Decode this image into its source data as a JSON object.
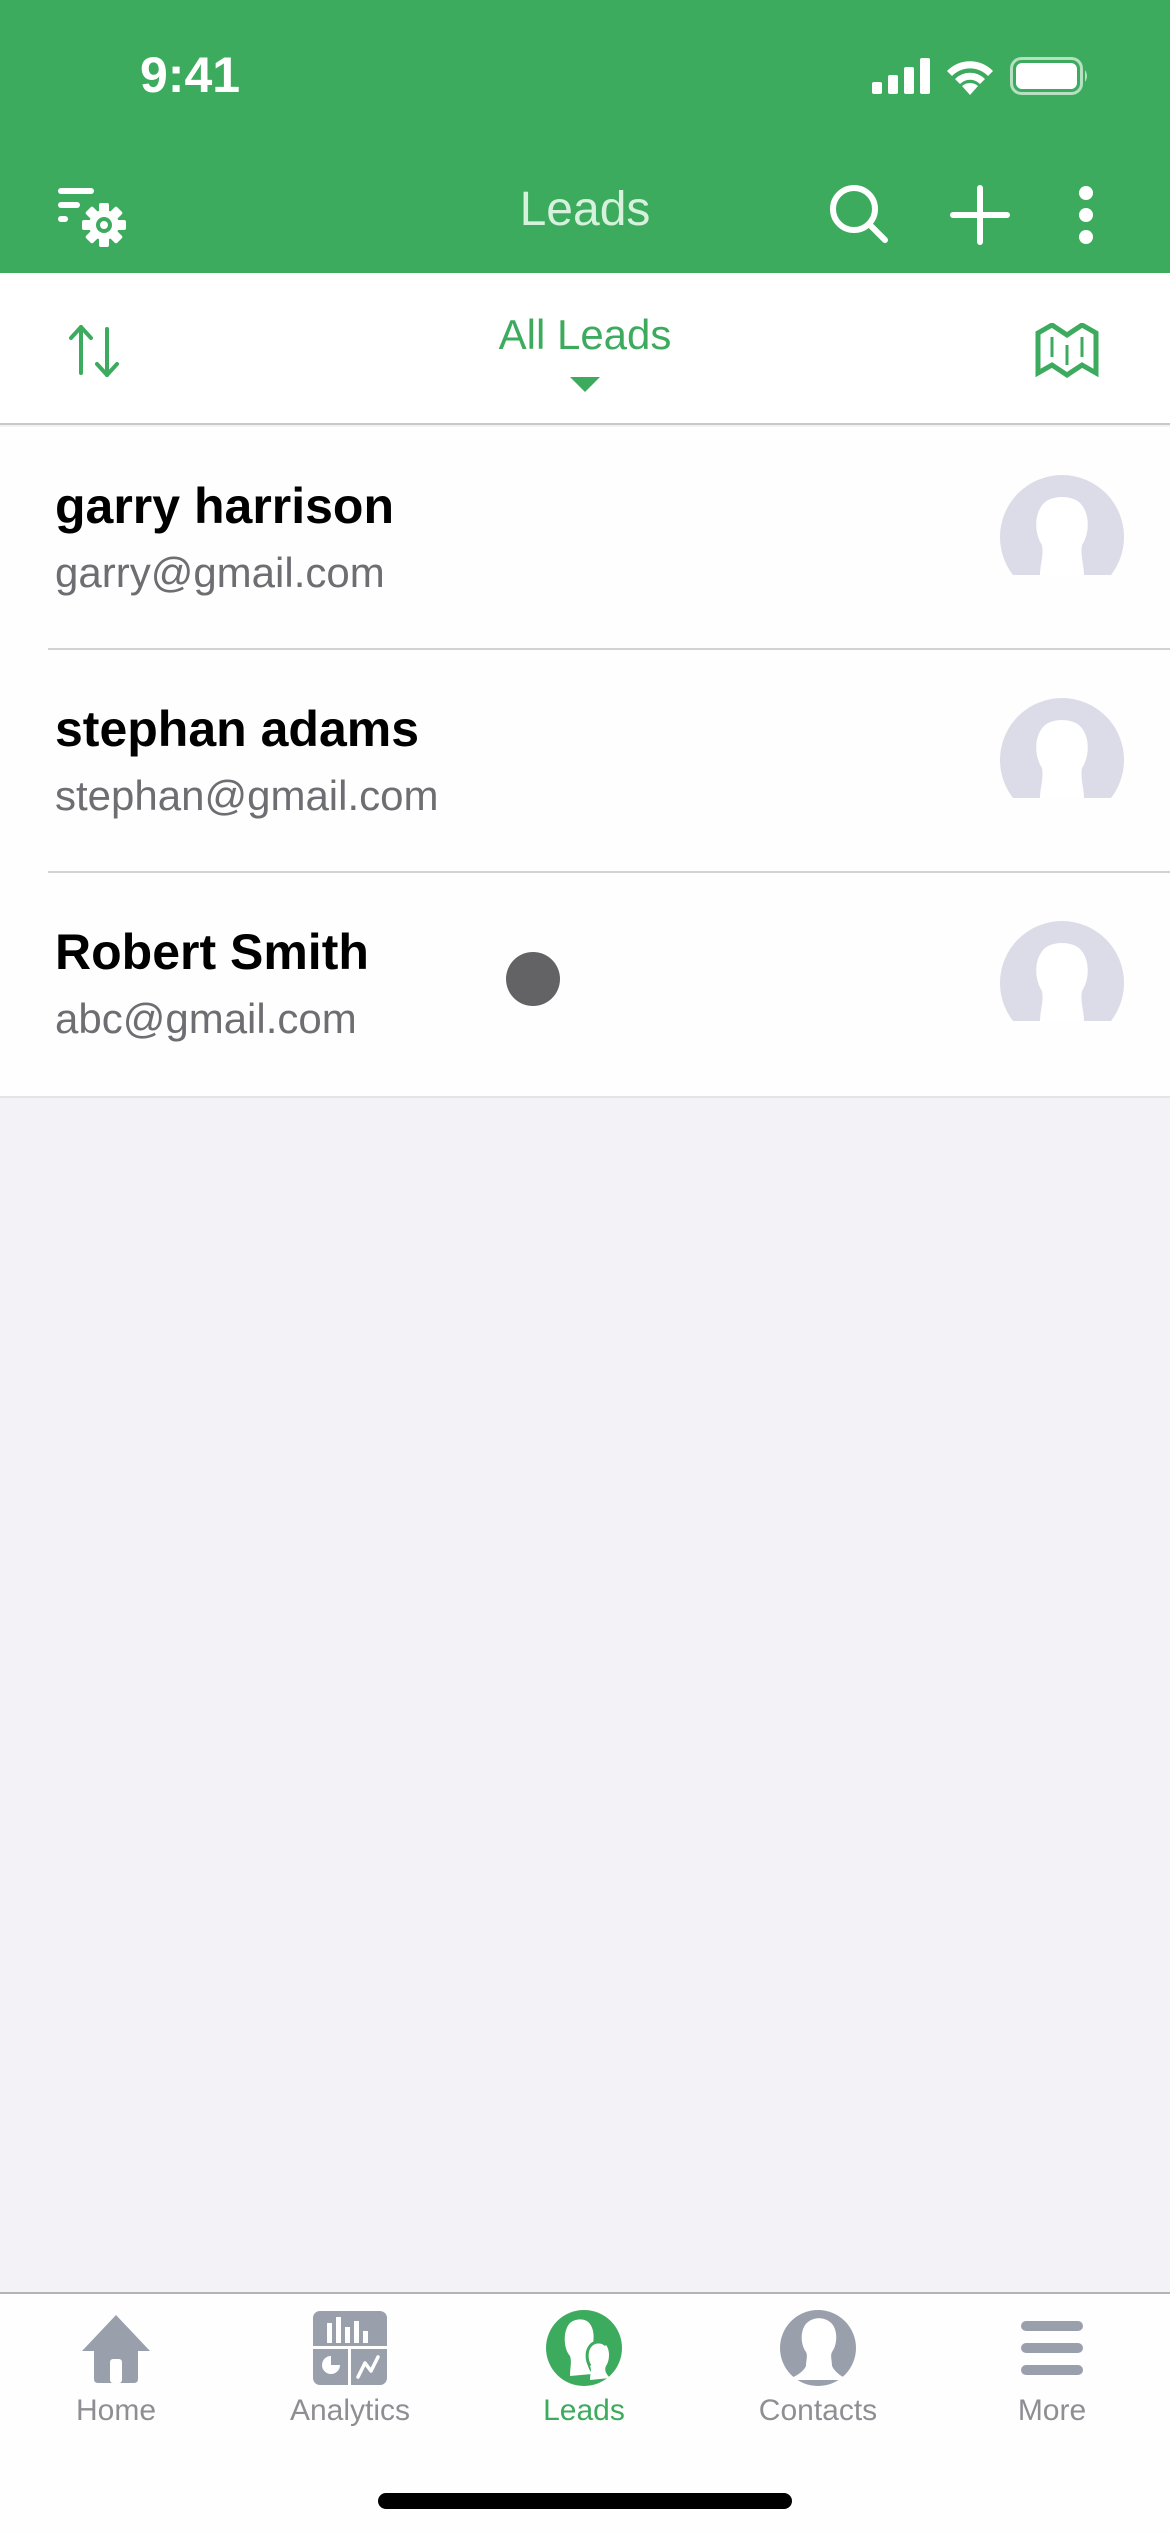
{
  "status_bar": {
    "time": "9:41"
  },
  "nav": {
    "title": "Leads",
    "icons": {
      "left": "filter-settings-icon",
      "search": "search-icon",
      "add": "plus-icon",
      "more": "more-vertical-icon"
    }
  },
  "filter": {
    "title": "All Leads",
    "sort_icon": "sort-icon",
    "map_icon": "map-icon"
  },
  "leads": [
    {
      "name": "garry harrison",
      "email": "garry@gmail.com"
    },
    {
      "name": "stephan adams",
      "email": "stephan@gmail.com"
    },
    {
      "name": "Robert Smith",
      "email": "abc@gmail.com"
    }
  ],
  "tabs": [
    {
      "label": "Home",
      "icon": "home-icon",
      "active": false
    },
    {
      "label": "Analytics",
      "icon": "analytics-icon",
      "active": false
    },
    {
      "label": "Leads",
      "icon": "leads-icon",
      "active": true
    },
    {
      "label": "Contacts",
      "icon": "contacts-icon",
      "active": false
    },
    {
      "label": "More",
      "icon": "menu-icon",
      "active": false
    }
  ],
  "colors": {
    "brand_green": "#3dab5e",
    "inactive_gray": "#8e8e93",
    "avatar_placeholder": "#dcdce8"
  }
}
